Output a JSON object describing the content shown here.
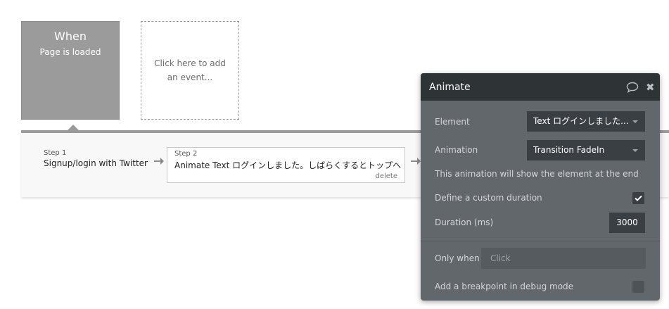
{
  "event": {
    "title": "When",
    "subtitle": "Page is loaded"
  },
  "add_event": {
    "label": "Click here to add an event..."
  },
  "steps": [
    {
      "label": "Step 1",
      "title": "Signup/login with Twitter"
    },
    {
      "label": "Step 2",
      "title": "Animate Text ログインしました。しばらくするとトップへ",
      "delete": "delete"
    }
  ],
  "panel": {
    "title": "Animate",
    "element_label": "Element",
    "element_value": "Text ログインしました...",
    "animation_label": "Animation",
    "animation_value": "Transition FadeIn",
    "note": "This animation will show the element at the end",
    "custom_duration_label": "Define a custom duration",
    "custom_duration_checked": true,
    "duration_label": "Duration (ms)",
    "duration_value": "3000",
    "only_when_label": "Only when",
    "only_when_placeholder": "Click",
    "breakpoint_label": "Add a breakpoint in debug mode",
    "breakpoint_checked": false
  },
  "icons": {
    "comment": "comment-icon",
    "close": "close-icon",
    "arrow": "arrow-right-icon",
    "check": "check-icon"
  }
}
